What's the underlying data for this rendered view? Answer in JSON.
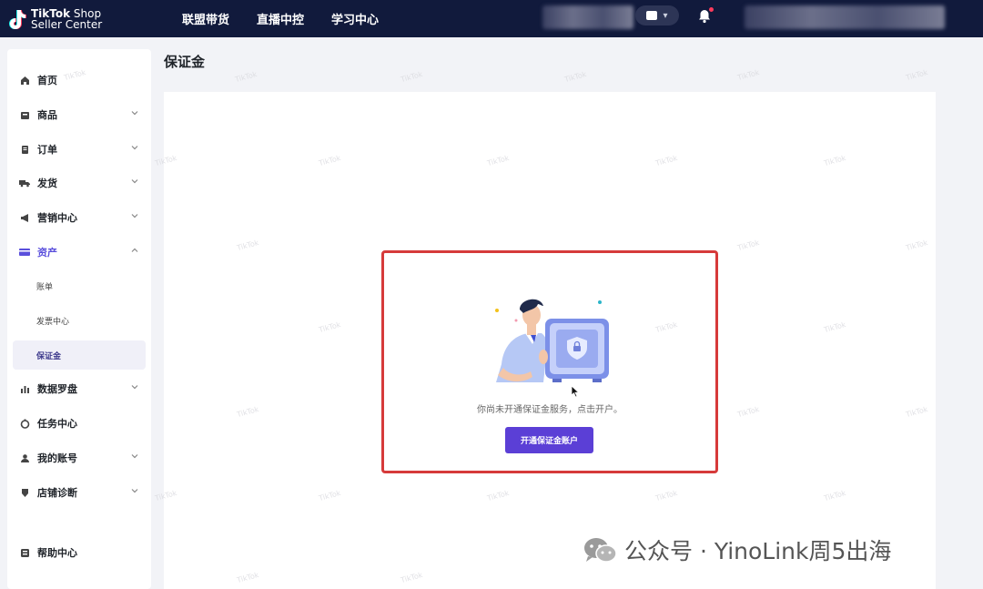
{
  "app": {
    "logo_line1_bold": "TikTok",
    "logo_line1_rest": " Shop",
    "logo_line2": "Seller Center"
  },
  "topnav": [
    "联盟带货",
    "直播中控",
    "学习中心"
  ],
  "sidebar": {
    "items": [
      {
        "label": "首页",
        "icon": "home-icon",
        "has_chevron": false
      },
      {
        "label": "商品",
        "icon": "product-icon",
        "has_chevron": true
      },
      {
        "label": "订单",
        "icon": "order-icon",
        "has_chevron": true
      },
      {
        "label": "发货",
        "icon": "truck-icon",
        "has_chevron": true
      },
      {
        "label": "营销中心",
        "icon": "megaphone-icon",
        "has_chevron": true
      },
      {
        "label": "资产",
        "icon": "wallet-icon",
        "has_chevron": true,
        "expanded": true
      },
      {
        "label": "数据罗盘",
        "icon": "chart-icon",
        "has_chevron": true
      },
      {
        "label": "任务中心",
        "icon": "task-icon",
        "has_chevron": false
      },
      {
        "label": "我的账号",
        "icon": "user-icon",
        "has_chevron": true
      },
      {
        "label": "店铺诊断",
        "icon": "diagnose-icon",
        "has_chevron": true
      },
      {
        "label": "帮助中心",
        "icon": "help-icon",
        "has_chevron": false
      }
    ],
    "assets_sub": [
      {
        "label": "账单"
      },
      {
        "label": "发票中心"
      },
      {
        "label": "保证金",
        "selected": true
      }
    ]
  },
  "main": {
    "page_title": "保证金",
    "empty_text": "你尚未开通保证金服务，点击开户。",
    "open_button_label": "开通保证金账户"
  },
  "watermark_text": "TikTok",
  "brand": {
    "text": "公众号 · YinoLink周5出海"
  },
  "colors": {
    "topbar": "#111a3c",
    "accent": "#5b3fd6",
    "highlight_border": "#d63a3a"
  }
}
